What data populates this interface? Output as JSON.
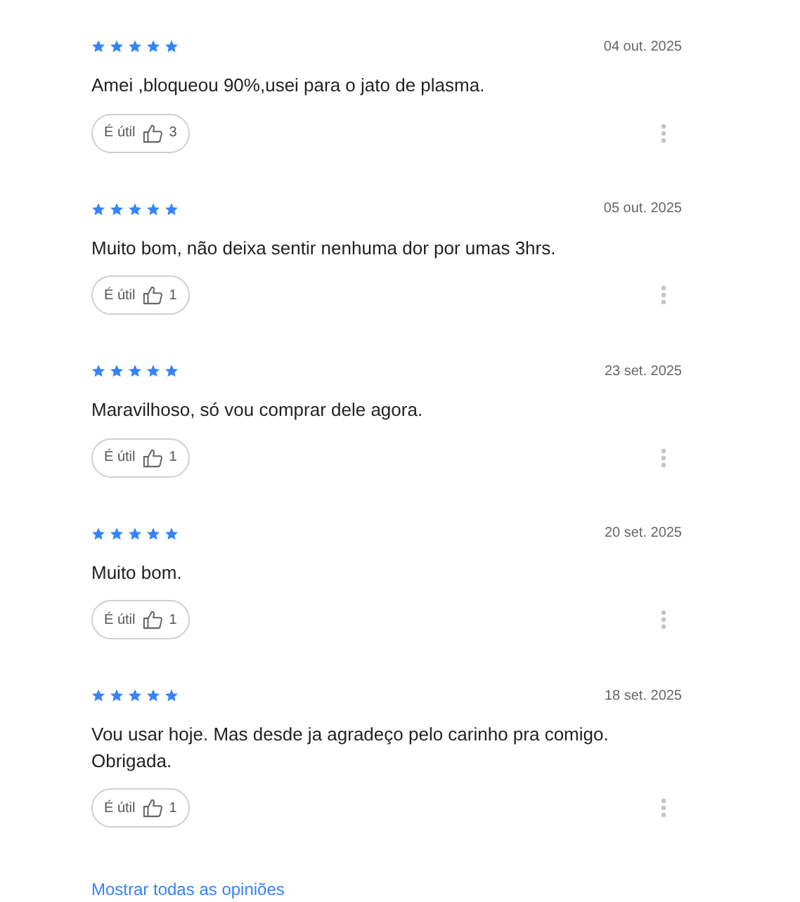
{
  "reviews": [
    {
      "stars": 5,
      "date": "04 out. 2025",
      "text": "Amei ,bloqueou 90%,usei para o jato de plasma.",
      "helpful_label": "É útil",
      "helpful_count": "3"
    },
    {
      "stars": 5,
      "date": "05 out. 2025",
      "text": "Muito bom, não deixa sentir nenhuma dor por umas 3hrs.",
      "helpful_label": "É útil",
      "helpful_count": "1"
    },
    {
      "stars": 5,
      "date": "23 set. 2025",
      "text": "Maravilhoso, só vou comprar dele agora.",
      "helpful_label": "É útil",
      "helpful_count": "1"
    },
    {
      "stars": 5,
      "date": "20 set. 2025",
      "text": "Muito bom.",
      "helpful_label": "É útil",
      "helpful_count": "1"
    },
    {
      "stars": 5,
      "date": "18 set. 2025",
      "text": "Vou usar hoje. Mas desde ja agradeço pelo carinho pra comigo. Obrigada.",
      "helpful_label": "É útil",
      "helpful_count": "1"
    }
  ],
  "show_all_link": "Mostrar todas as opiniões"
}
